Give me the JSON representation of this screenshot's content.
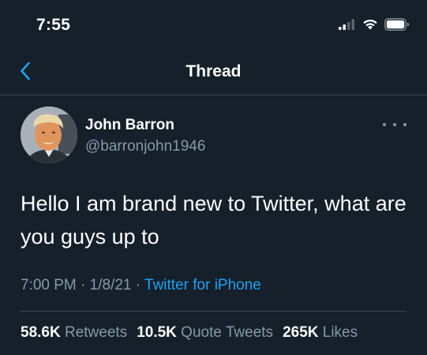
{
  "status_bar": {
    "time": "7:55",
    "icons": [
      "cellular-signal-icon",
      "wifi-icon",
      "battery-icon"
    ]
  },
  "nav": {
    "title": "Thread",
    "back_icon": "chevron-left-icon"
  },
  "tweet": {
    "author_name": "John Barron",
    "author_handle": "@barronjohn1946",
    "text": "Hello I am brand new to Twitter, what are you guys up to",
    "time": "7:00 PM",
    "date": "1/8/21",
    "separator": "·",
    "source": "Twitter for iPhone",
    "stats": [
      {
        "value": "58.6K",
        "label": "Retweets"
      },
      {
        "value": "10.5K",
        "label": "Quote Tweets"
      },
      {
        "value": "265K",
        "label": "Likes"
      }
    ]
  },
  "colors": {
    "background": "#15202b",
    "accent": "#1da1f2",
    "secondary_text": "#8899a6",
    "divider": "#38444d"
  }
}
